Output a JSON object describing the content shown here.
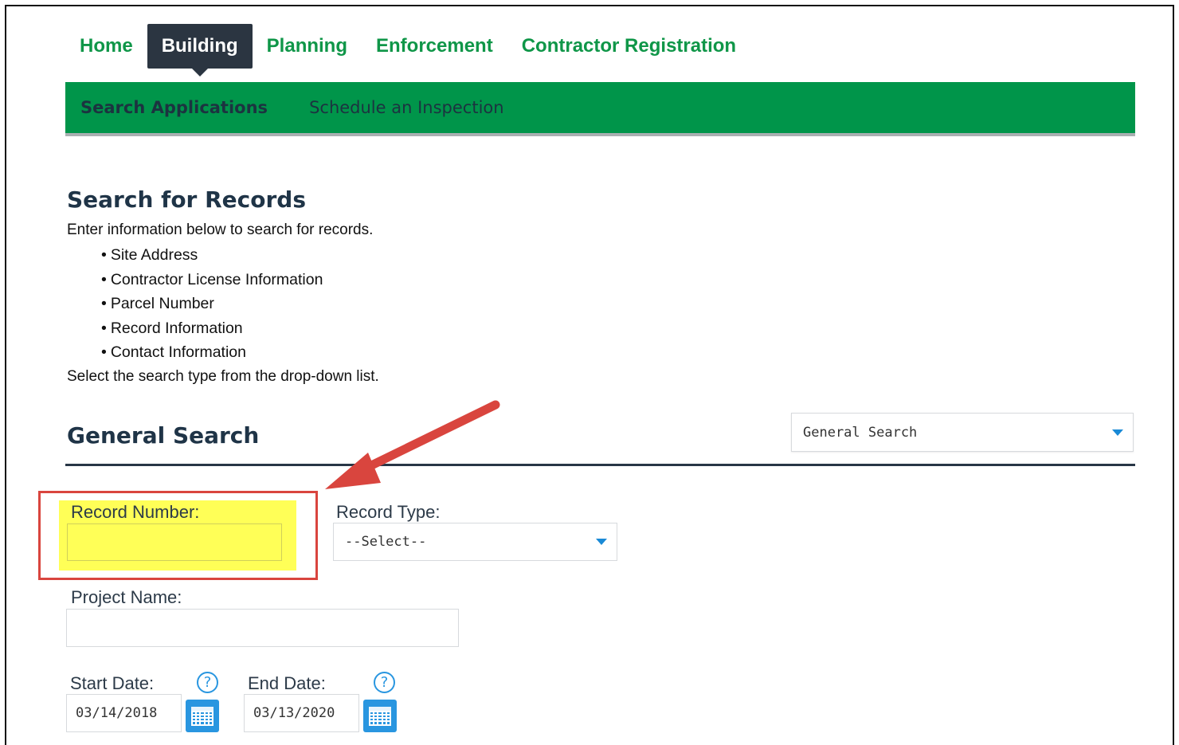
{
  "nav": {
    "tabs": [
      {
        "label": "Home"
      },
      {
        "label": "Building",
        "active": true
      },
      {
        "label": "Planning"
      },
      {
        "label": "Enforcement"
      },
      {
        "label": "Contractor Registration"
      }
    ]
  },
  "subnav": {
    "items": [
      {
        "label": "Search Applications",
        "active": true
      },
      {
        "label": "Schedule an Inspection"
      }
    ]
  },
  "instructions": {
    "title": "Search for Records",
    "intro": "Enter information below to search for records.",
    "bullets": [
      "Site Address",
      "Contractor License Information",
      "Parcel Number",
      "Record Information",
      "Contact Information"
    ],
    "outro": "Select the search type from the drop-down list."
  },
  "general_search": {
    "title": "General Search",
    "search_type": {
      "selected": "General Search"
    },
    "record_number": {
      "label": "Record Number:",
      "value": ""
    },
    "record_type": {
      "label": "Record Type:",
      "selected": "--Select--"
    },
    "project_name": {
      "label": "Project Name:",
      "value": ""
    },
    "start_date": {
      "label": "Start Date:",
      "value": "03/14/2018",
      "help": "?"
    },
    "end_date": {
      "label": "End Date:",
      "value": "03/13/2020",
      "help": "?"
    }
  },
  "colors": {
    "brand_green": "#00954a",
    "nav_green": "#0f9648",
    "nav_active_bg": "#2b3541",
    "highlight": "#ffff57",
    "callout_red": "#d9453e",
    "accent_blue": "#2996e0"
  }
}
